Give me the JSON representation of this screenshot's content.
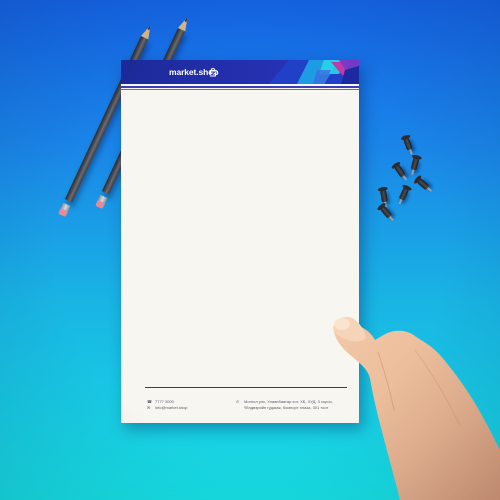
{
  "brand": {
    "name": "market.shop",
    "primary_color": "#2530b0",
    "accent_color": "#d13ca0",
    "logo_icon": "shopping-bag-icon"
  },
  "letterhead": {
    "contact_left": [
      {
        "icon": "phone-icon",
        "text": "7777 3000"
      },
      {
        "icon": "mail-icon",
        "text": "info@market.shop"
      }
    ],
    "contact_right": [
      {
        "icon": "location-pin-icon",
        "text": "Монгол улс, Улаанбаатар хот, ХБ, ХУД, 3 хороо,"
      },
      {
        "icon": "",
        "text": "Үйлдвэрийн гудамж, Компорт плаза, 301 тоот"
      }
    ]
  },
  "scene": {
    "background_top": "#1565e6",
    "background_bottom": "#17dfe3",
    "objects": [
      "pencil",
      "pencil",
      "push-pins",
      "hand"
    ]
  }
}
